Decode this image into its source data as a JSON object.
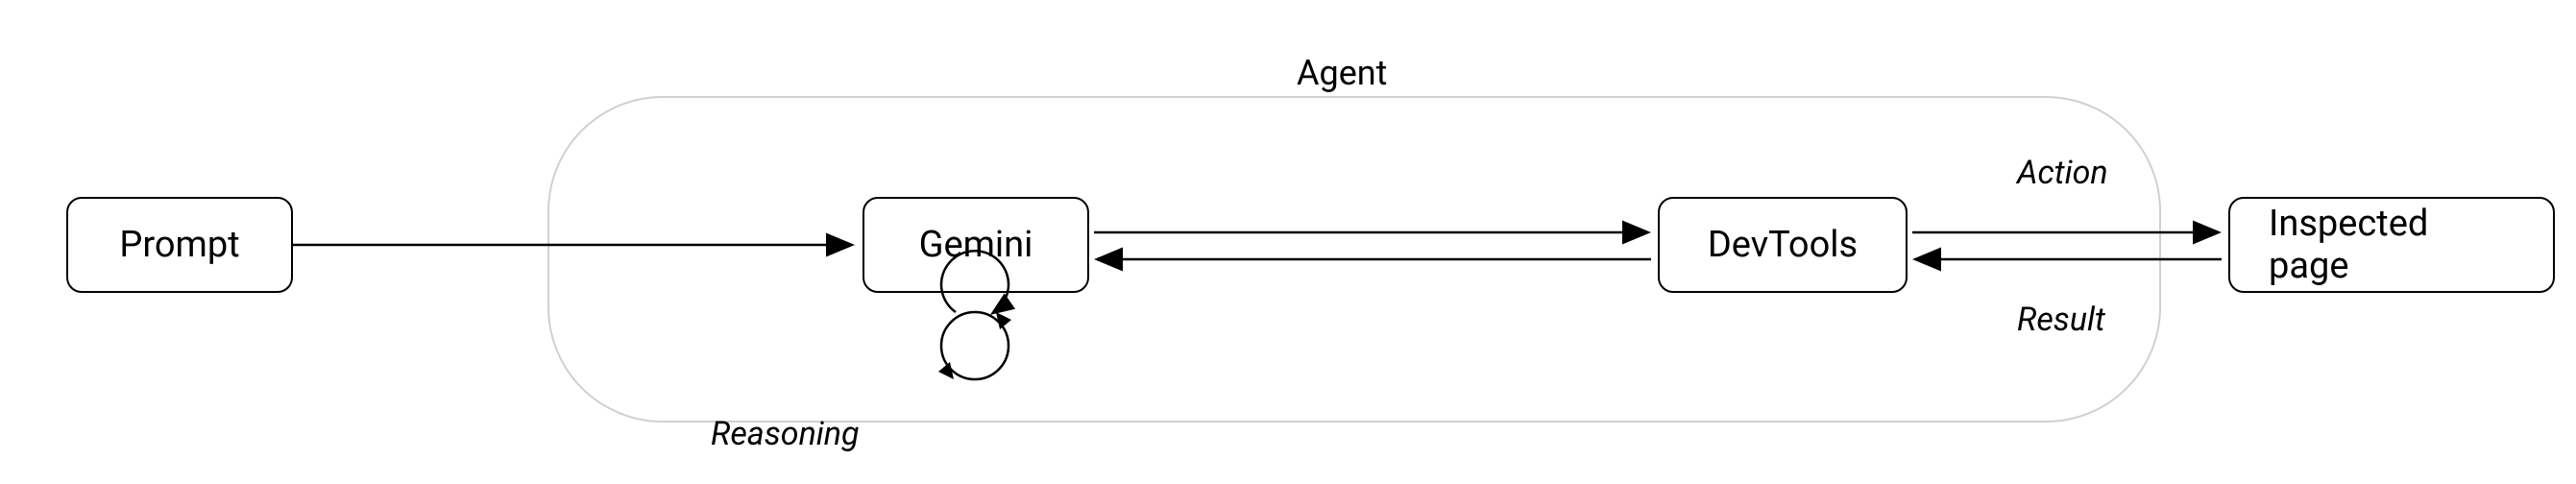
{
  "nodes": {
    "prompt": "Prompt",
    "gemini": "Gemini",
    "devtools": "DevTools",
    "inspected": "Inspected page"
  },
  "labels": {
    "agent": "Agent",
    "reasoning": "Reasoning",
    "action": "Action",
    "result": "Result"
  },
  "arrows": {
    "prompt_to_gemini": "unidirectional",
    "gemini_to_devtools": "bidirectional",
    "devtools_to_inspected": "bidirectional",
    "gemini_self": "self-loop"
  }
}
